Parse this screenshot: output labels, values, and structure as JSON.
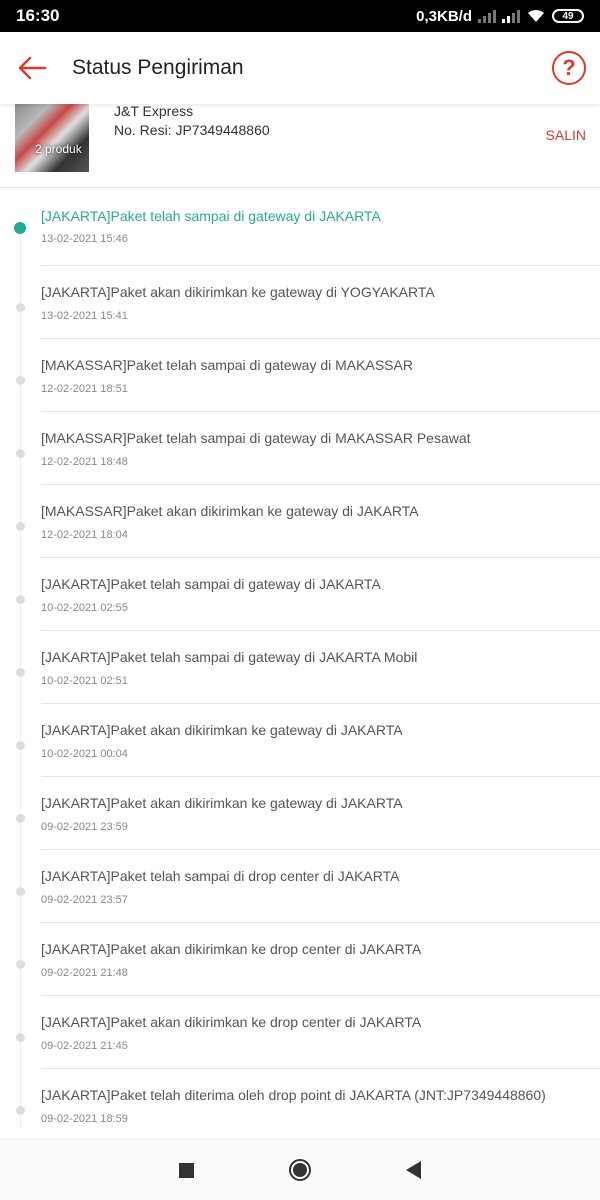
{
  "statusbar": {
    "time": "16:30",
    "speed": "0,3KB/d",
    "battery": "49"
  },
  "header": {
    "title": "Status Pengiriman",
    "help_label": "?"
  },
  "shipment": {
    "thumb_label": "2 produk",
    "courier": "J&T Express",
    "resi": "No. Resi:  JP7349448860",
    "copy_label": "SALIN"
  },
  "colors": {
    "accent": "#d93a2b",
    "active": "#26aa99"
  },
  "events": [
    {
      "desc": "[JAKARTA]Paket telah sampai di gateway di JAKARTA",
      "time": "13-02-2021 15:46"
    },
    {
      "desc": "[JAKARTA]Paket akan dikirimkan ke gateway di YOGYAKARTA",
      "time": "13-02-2021 15:41"
    },
    {
      "desc": "[MAKASSAR]Paket telah sampai di gateway di MAKASSAR",
      "time": "12-02-2021 18:51"
    },
    {
      "desc": "[MAKASSAR]Paket telah sampai di gateway di MAKASSAR Pesawat",
      "time": "12-02-2021 18:48"
    },
    {
      "desc": "[MAKASSAR]Paket akan dikirimkan ke gateway di JAKARTA",
      "time": "12-02-2021 18:04"
    },
    {
      "desc": "[JAKARTA]Paket telah sampai di gateway di JAKARTA",
      "time": "10-02-2021 02:55"
    },
    {
      "desc": "[JAKARTA]Paket telah sampai di gateway di JAKARTA Mobil",
      "time": "10-02-2021 02:51"
    },
    {
      "desc": "[JAKARTA]Paket akan dikirimkan ke gateway di JAKARTA",
      "time": "10-02-2021 00:04"
    },
    {
      "desc": "[JAKARTA]Paket akan dikirimkan ke gateway di JAKARTA",
      "time": "09-02-2021 23:59"
    },
    {
      "desc": "[JAKARTA]Paket telah sampai di drop center di JAKARTA",
      "time": "09-02-2021 23:57"
    },
    {
      "desc": "[JAKARTA]Paket akan dikirimkan ke drop center di JAKARTA",
      "time": "09-02-2021 21:48"
    },
    {
      "desc": "[JAKARTA]Paket akan dikirimkan ke drop center di JAKARTA",
      "time": "09-02-2021 21:45"
    },
    {
      "desc": "[JAKARTA]Paket telah diterima oleh drop point di JAKARTA (JNT:JP7349448860)",
      "time": "09-02-2021 18:59"
    }
  ]
}
